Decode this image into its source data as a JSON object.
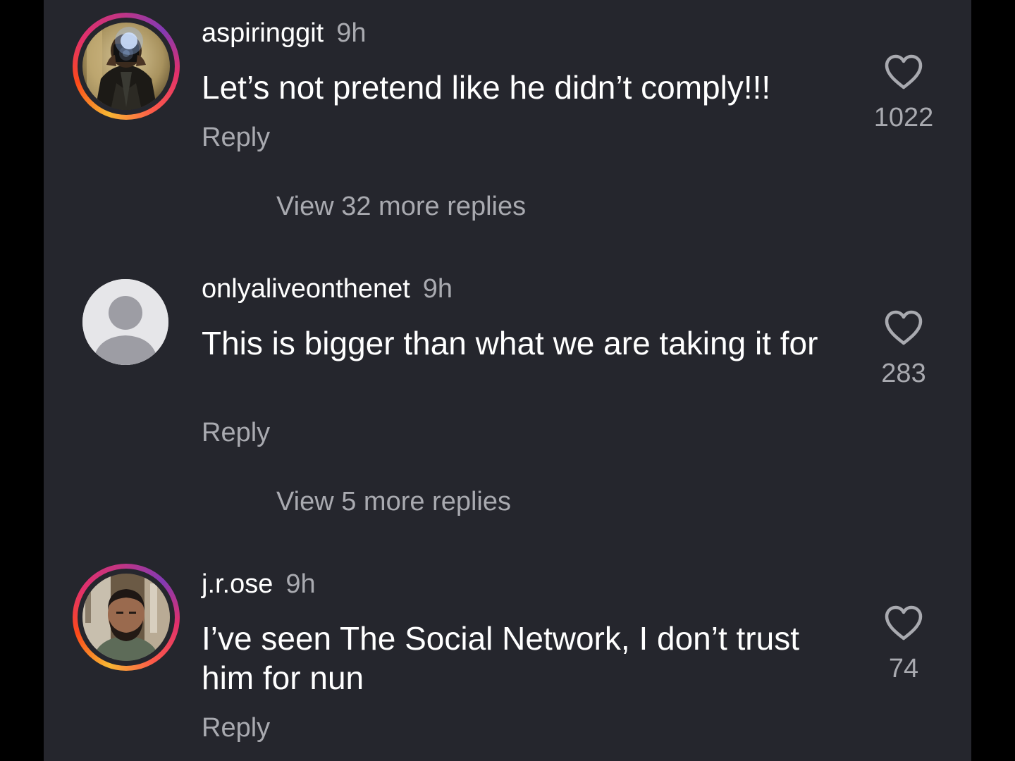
{
  "comments": [
    {
      "username": "aspiringgit",
      "time": "9h",
      "text": "Let’s not pretend like he didn’t comply!!!",
      "reply_label": "Reply",
      "likes": "1022",
      "view_more": "View 32 more replies",
      "avatar": "photographer-photo",
      "story_ring": true
    },
    {
      "username": "onlyaliveonthenet",
      "time": "9h",
      "text": "This is bigger than what we are taking it for",
      "reply_label": "Reply",
      "likes": "283",
      "view_more": "View 5 more replies",
      "avatar": "default-user-icon",
      "story_ring": false
    },
    {
      "username": "j.r.ose",
      "time": "9h",
      "text": "I’ve seen The Social Network, I don’t trust him for nun",
      "reply_label": "Reply",
      "likes": "74",
      "avatar": "man-portrait-photo",
      "story_ring": true
    }
  ],
  "colors": {
    "background": "#25262d",
    "primary_text": "#ffffff",
    "secondary_text": "#a9aab0",
    "ring_gradient": [
      "#f7b733",
      "#e1306c",
      "#833ab4"
    ]
  }
}
